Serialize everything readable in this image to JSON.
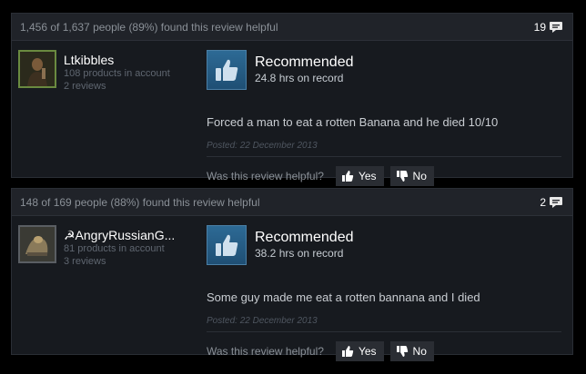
{
  "reviews": [
    {
      "helpful_summary": "1,456 of 1,637 people (89%) found this review helpful",
      "comment_count": "19",
      "username": "Ltkibbles",
      "products": "108 products in account",
      "review_count": "2 reviews",
      "verdict": "Recommended",
      "hours": "24.8 hrs on record",
      "text": "Forced a man to eat a rotten Banana and he died 10/10",
      "posted": "Posted: 22 December 2013",
      "helpful_question": "Was this review helpful?",
      "yes_label": "Yes",
      "no_label": "No"
    },
    {
      "helpful_summary": "148 of 169 people (88%) found this review helpful",
      "comment_count": "2",
      "username": "☭AngryRussianG...",
      "products": "81 products in account",
      "review_count": "3 reviews",
      "verdict": "Recommended",
      "hours": "38.2 hrs on record",
      "text": "Some guy made me eat a rotten bannana and I died",
      "posted": "Posted: 22 December 2013",
      "helpful_question": "Was this review helpful?",
      "yes_label": "Yes",
      "no_label": "No"
    }
  ],
  "colors": {
    "background": "#000000",
    "card": "#171a1f",
    "header": "#202329",
    "thumb_blue": "#2d6a95",
    "online_border": "#6a8a40",
    "offline_border": "#5a5e63"
  },
  "icons": {
    "comment": "speech-bubble-icon",
    "recommended": "thumbs-up-icon",
    "vote_yes": "thumbs-up-small-icon",
    "vote_no": "thumbs-down-small-icon"
  }
}
